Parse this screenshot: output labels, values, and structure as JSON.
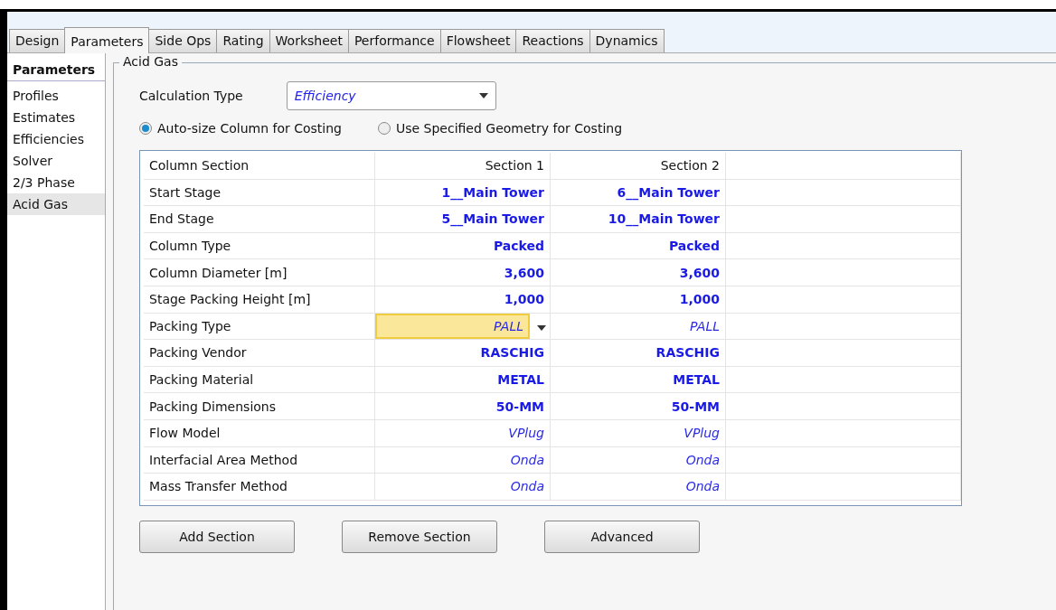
{
  "tabs": [
    {
      "label": "Design",
      "selected": false
    },
    {
      "label": "Parameters",
      "selected": true
    },
    {
      "label": "Side Ops",
      "selected": false
    },
    {
      "label": "Rating",
      "selected": false
    },
    {
      "label": "Worksheet",
      "selected": false
    },
    {
      "label": "Performance",
      "selected": false
    },
    {
      "label": "Flowsheet",
      "selected": false
    },
    {
      "label": "Reactions",
      "selected": false
    },
    {
      "label": "Dynamics",
      "selected": false
    }
  ],
  "sidebar": {
    "title": "Parameters",
    "items": [
      {
        "label": "Profiles",
        "selected": false
      },
      {
        "label": "Estimates",
        "selected": false
      },
      {
        "label": "Efficiencies",
        "selected": false
      },
      {
        "label": "Solver",
        "selected": false
      },
      {
        "label": "2/3 Phase",
        "selected": false
      },
      {
        "label": "Acid Gas",
        "selected": true
      }
    ]
  },
  "group": {
    "title": "Acid Gas",
    "calculation_type": {
      "label": "Calculation Type",
      "value": "Efficiency"
    },
    "radios": [
      {
        "label": "Auto-size Column for Costing",
        "selected": true
      },
      {
        "label": "Use Specified Geometry for Costing",
        "selected": false
      }
    ],
    "table": {
      "columns": [
        "Column Section",
        "Section 1",
        "Section 2"
      ],
      "rows": [
        {
          "cells": [
            {
              "text": "Start Stage",
              "kind": "plain",
              "selected": false
            },
            {
              "text": "1__Main Tower",
              "kind": "bold",
              "selected": false
            },
            {
              "text": "6__Main Tower",
              "kind": "bold",
              "selected": false
            }
          ]
        },
        {
          "cells": [
            {
              "text": "End Stage",
              "kind": "plain",
              "selected": false
            },
            {
              "text": "5__Main Tower",
              "kind": "bold",
              "selected": false
            },
            {
              "text": "10__Main Tower",
              "kind": "bold",
              "selected": false
            }
          ]
        },
        {
          "cells": [
            {
              "text": "Column Type",
              "kind": "plain",
              "selected": false
            },
            {
              "text": "Packed",
              "kind": "bold",
              "selected": false
            },
            {
              "text": "Packed",
              "kind": "bold",
              "selected": false
            }
          ]
        },
        {
          "cells": [
            {
              "text": "Column Diameter [m]",
              "kind": "plain",
              "selected": false
            },
            {
              "text": "3,600",
              "kind": "bold",
              "selected": false
            },
            {
              "text": "3,600",
              "kind": "bold",
              "selected": false
            }
          ]
        },
        {
          "cells": [
            {
              "text": "Stage Packing Height [m]",
              "kind": "plain",
              "selected": false
            },
            {
              "text": "1,000",
              "kind": "bold",
              "selected": false
            },
            {
              "text": "1,000",
              "kind": "bold",
              "selected": false
            }
          ]
        },
        {
          "cells": [
            {
              "text": "Packing Type",
              "kind": "plain",
              "selected": false
            },
            {
              "text": "PALL",
              "kind": "italic",
              "selected": true
            },
            {
              "text": "PALL",
              "kind": "italic",
              "selected": false
            }
          ]
        },
        {
          "cells": [
            {
              "text": "Packing Vendor",
              "kind": "plain",
              "selected": false
            },
            {
              "text": "RASCHIG",
              "kind": "bold",
              "selected": false
            },
            {
              "text": "RASCHIG",
              "kind": "bold",
              "selected": false
            }
          ]
        },
        {
          "cells": [
            {
              "text": "Packing Material",
              "kind": "plain",
              "selected": false
            },
            {
              "text": "METAL",
              "kind": "bold",
              "selected": false
            },
            {
              "text": "METAL",
              "kind": "bold",
              "selected": false
            }
          ]
        },
        {
          "cells": [
            {
              "text": "Packing Dimensions",
              "kind": "plain",
              "selected": false
            },
            {
              "text": "50-MM",
              "kind": "bold",
              "selected": false
            },
            {
              "text": "50-MM",
              "kind": "bold",
              "selected": false
            }
          ]
        },
        {
          "cells": [
            {
              "text": "Flow Model",
              "kind": "plain",
              "selected": false
            },
            {
              "text": "VPlug",
              "kind": "italic",
              "selected": false
            },
            {
              "text": "VPlug",
              "kind": "italic",
              "selected": false
            }
          ]
        },
        {
          "cells": [
            {
              "text": "Interfacial Area Method",
              "kind": "plain",
              "selected": false
            },
            {
              "text": "Onda",
              "kind": "italic",
              "selected": false
            },
            {
              "text": "Onda",
              "kind": "italic",
              "selected": false
            }
          ]
        },
        {
          "cells": [
            {
              "text": "Mass Transfer Method",
              "kind": "plain",
              "selected": false
            },
            {
              "text": "Onda",
              "kind": "italic",
              "selected": false
            },
            {
              "text": "Onda",
              "kind": "italic",
              "selected": false
            }
          ]
        }
      ]
    },
    "buttons": [
      "Add Section",
      "Remove Section",
      "Advanced"
    ]
  }
}
